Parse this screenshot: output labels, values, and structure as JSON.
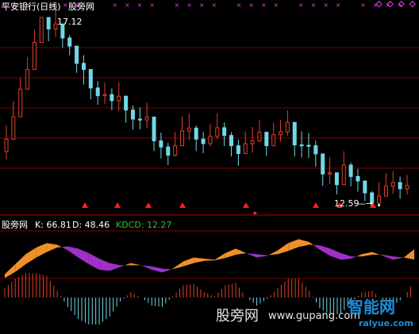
{
  "top_panel": {
    "title": "平安银行(日线)",
    "indicator": "股旁网",
    "high_label": "17.12",
    "low_label": "12.59",
    "low_arrow": "—→"
  },
  "bottom_panel": {
    "indicator": "股旁网",
    "k_label": "K: 66.81",
    "d_label": "D: 48.46",
    "kdcd_label": "KDCD: 12.27"
  },
  "watermarks": {
    "site_cn": "股旁网",
    "site_url": "www.gupang.com",
    "brand_cn": "智能网",
    "brand_url": "ralyue.com"
  },
  "colors": {
    "background": "#000000",
    "grid": "#7a0000",
    "up": "#e0402a",
    "down": "#70d8e8",
    "k_fill": "#f0902a",
    "d_fill": "#a030c8",
    "marker_cross": "#e040e0",
    "marker_tri": "#ff2020",
    "kdcd_text": "#30c030"
  },
  "chart_data": [
    {
      "type": "candlestick",
      "title": "平安银行(日线)",
      "series": [
        {
          "name": "close",
          "values": [
            14.15,
            14.7,
            15.37,
            15.85,
            16.51,
            17.12,
            16.84,
            16.96,
            16.62,
            16.42,
            16.0,
            15.85,
            15.4,
            15.21,
            15.24,
            15.09,
            15.2,
            14.86,
            14.64,
            14.62,
            14.69,
            14.11,
            13.96,
            13.76,
            13.99,
            14.35,
            14.42,
            14.15,
            14.04,
            14.22,
            14.43,
            14.24,
            13.99,
            13.8,
            14.04,
            14.11,
            14.32,
            13.99,
            14.26,
            14.33,
            14.56,
            14.01,
            14.0,
            13.99,
            13.79,
            13.3,
            13.33,
            13.04,
            13.52,
            13.24,
            13.13,
            12.84,
            12.59,
            12.76,
            13.0,
            13.09,
            12.94,
            13.02
          ]
        },
        {
          "name": "high",
          "values": [
            14.48,
            15.08,
            15.65,
            16.15,
            16.82,
            17.12,
            17.13,
            17.29,
            16.91,
            16.69,
            16.29,
            16.2,
            15.68,
            15.57,
            15.53,
            15.39,
            15.54,
            15.18,
            14.97,
            14.93,
            15.04,
            14.44,
            14.31,
            14.06,
            14.33,
            14.7,
            14.78,
            14.48,
            14.33,
            14.52,
            14.79,
            14.56,
            14.32,
            14.14,
            14.34,
            14.45,
            14.62,
            14.32,
            14.56,
            14.62,
            14.85,
            14.32,
            14.34,
            14.3,
            14.11,
            13.6,
            13.7,
            13.32,
            13.86,
            13.58,
            13.43,
            13.14,
            12.88,
            13.1,
            13.32,
            13.37,
            13.24,
            13.28
          ]
        },
        {
          "name": "low",
          "values": [
            13.66,
            14.13,
            14.89,
            15.5,
            16.26,
            16.67,
            16.54,
            16.65,
            16.38,
            16.2,
            15.77,
            15.48,
            15.12,
            14.99,
            15.01,
            14.86,
            14.85,
            14.55,
            14.38,
            14.39,
            14.41,
            13.86,
            13.68,
            13.52,
            13.73,
            14.04,
            14.12,
            13.86,
            13.81,
            13.98,
            14.15,
            13.98,
            13.73,
            13.5,
            13.81,
            13.82,
            14.08,
            13.74,
            13.98,
            14.09,
            14.24,
            13.73,
            13.7,
            13.69,
            13.48,
            13.01,
            13.06,
            12.8,
            13.22,
            13.0,
            12.87,
            12.64,
            12.59,
            12.54,
            12.76,
            12.82,
            12.7,
            12.8
          ]
        }
      ],
      "markers": {
        "crosses_count": 34,
        "triangles_count": 9
      },
      "annotations": [
        "17.12",
        "12.59"
      ],
      "grid": true
    },
    {
      "type": "area",
      "title": "股旁网",
      "series": [
        {
          "name": "K",
          "last": 66.81,
          "values": [
            22,
            40,
            58,
            70,
            78,
            75,
            65,
            52,
            40,
            30,
            28,
            35,
            42,
            38,
            30,
            25,
            32,
            45,
            52,
            50,
            48,
            60,
            68,
            60,
            52,
            55,
            65,
            78,
            85,
            80,
            66,
            55,
            48,
            50,
            58,
            62,
            55,
            48,
            52,
            66.81
          ]
        },
        {
          "name": "D",
          "last": 48.46,
          "values": [
            15,
            26,
            40,
            52,
            62,
            70,
            72,
            68,
            60,
            50,
            42,
            38,
            38,
            38,
            36,
            32,
            31,
            36,
            42,
            46,
            47,
            51,
            57,
            60,
            58,
            56,
            58,
            64,
            71,
            75,
            74,
            68,
            60,
            54,
            54,
            57,
            57,
            54,
            52,
            48.46
          ]
        },
        {
          "name": "KDCD",
          "last": 12.27,
          "values": [
            7,
            14,
            18,
            18,
            16,
            5,
            -7,
            -16,
            -20,
            -20,
            -14,
            -3,
            4,
            0,
            -6,
            -7,
            1,
            9,
            10,
            4,
            1,
            9,
            11,
            0,
            -6,
            -1,
            7,
            14,
            14,
            5,
            -8,
            -13,
            -12,
            -4,
            4,
            5,
            -2,
            -6,
            0,
            12.27
          ]
        }
      ],
      "grid": true
    }
  ]
}
